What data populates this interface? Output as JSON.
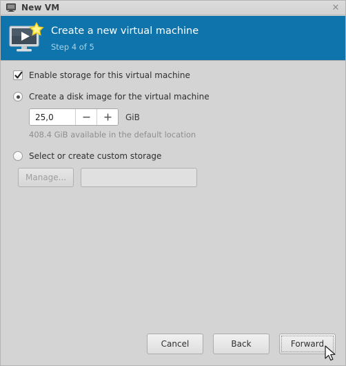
{
  "window": {
    "title": "New VM",
    "icon": "computer-icon",
    "close_label": "✕"
  },
  "banner": {
    "icon": "new-vm-monitor-star-icon",
    "title": "Create a new virtual machine",
    "step": "Step 4 of 5",
    "background_color": "#0e74ab",
    "step_color": "#a7d4ea"
  },
  "form": {
    "enable_storage": {
      "label": "Enable storage for this virtual machine",
      "checked": true
    },
    "create_disk_image": {
      "label": "Create a disk image for the virtual machine",
      "selected": true
    },
    "disk_size": {
      "value": "25,0",
      "unit": "GiB",
      "decrement_label": "−",
      "increment_label": "+"
    },
    "availability_note": "408.4 GiB available in the default location",
    "custom_storage": {
      "label": "Select or create custom storage",
      "selected": false,
      "manage_label": "Manage...",
      "path_value": "",
      "path_placeholder": ""
    }
  },
  "footer": {
    "cancel_label": "Cancel",
    "back_label": "Back",
    "forward_label": "Forward",
    "focused_button": "Forward"
  }
}
